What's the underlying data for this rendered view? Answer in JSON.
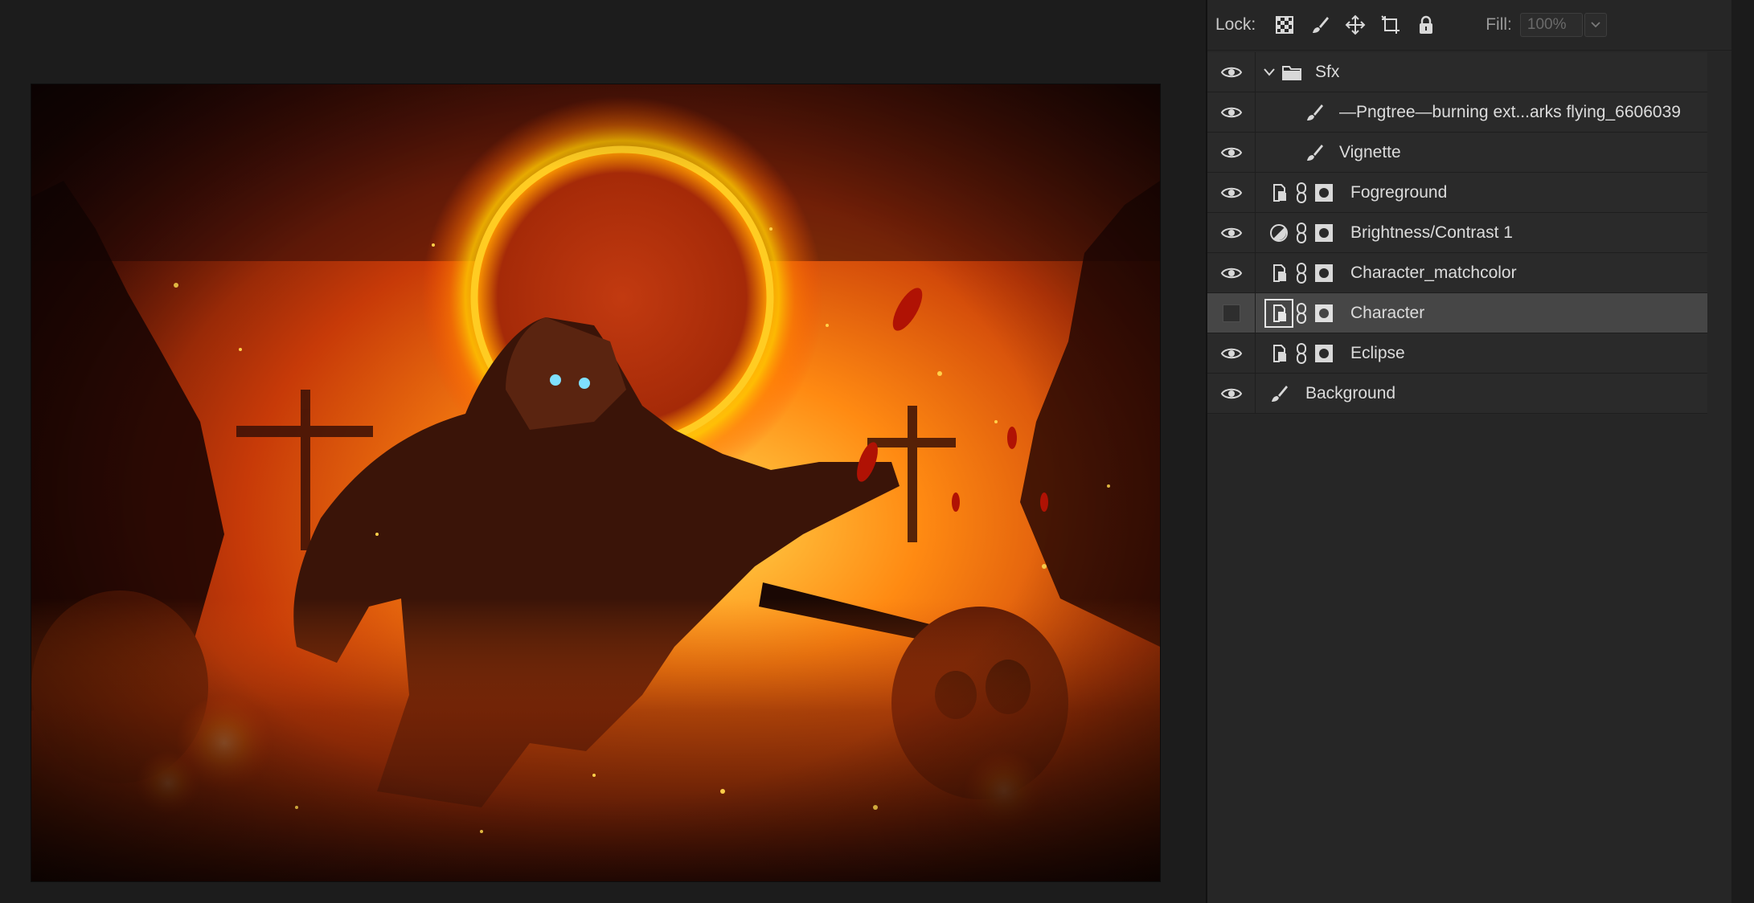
{
  "lock_bar": {
    "lock_label": "Lock:",
    "fill_label": "Fill:",
    "fill_value": "100%"
  },
  "layers": [
    {
      "name": "Sfx",
      "kind": "group",
      "icon": "folder-icon",
      "visible": true,
      "expanded": true
    },
    {
      "name": "—Pngtree—burning ext...arks flying_6606039",
      "kind": "pixel",
      "icon": "brush-icon",
      "visible": true,
      "indent": 1
    },
    {
      "name": "Vignette",
      "kind": "pixel",
      "icon": "brush-icon",
      "visible": true,
      "indent": 1
    },
    {
      "name": "Fogreground",
      "kind": "smart",
      "icon": "smart-object-icon",
      "visible": true
    },
    {
      "name": "Brightness/Contrast 1",
      "kind": "adjustment",
      "icon": "adjustment-icon",
      "visible": true
    },
    {
      "name": "Character_matchcolor",
      "kind": "smart",
      "icon": "smart-object-icon",
      "visible": true
    },
    {
      "name": "Character",
      "kind": "smart",
      "icon": "smart-object-icon",
      "visible": false,
      "selected": true
    },
    {
      "name": "Eclipse",
      "kind": "smart",
      "icon": "smart-object-icon",
      "visible": true
    },
    {
      "name": "Background",
      "kind": "pixel",
      "icon": "brush-icon",
      "visible": true
    }
  ],
  "colors": {
    "panel_bg": "#262626",
    "row_bg": "#2a2a2a",
    "selected_row": "#464646",
    "canvas_bg": "#1c1c1c",
    "eclipse_ring": "#ffb400",
    "fire_orange": "#ff6a00"
  }
}
